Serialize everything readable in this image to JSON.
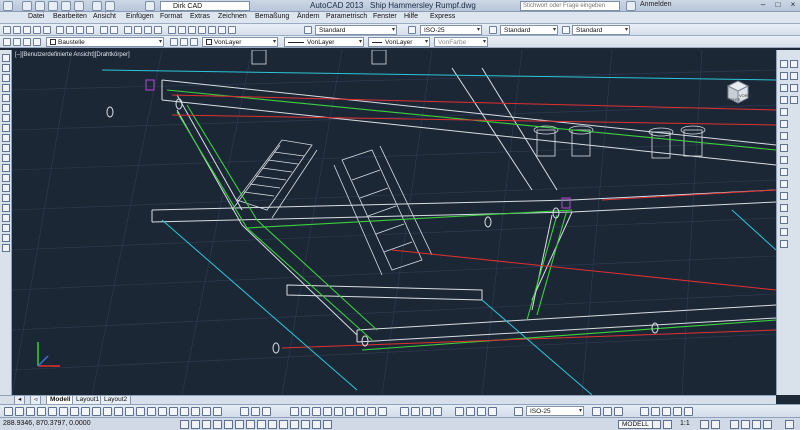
{
  "titlebar": {
    "workspace": "Dirk CAD",
    "app_name": "AutoCAD 2013",
    "document": "Ship Hammersley Rumpf.dwg",
    "search_placeholder": "Stichwort oder Frage eingeben",
    "login": "Anmelden"
  },
  "menu": [
    "Datei",
    "Bearbeiten",
    "Ansicht",
    "Einfügen",
    "Format",
    "Extras",
    "Zeichnen",
    "Bemaßung",
    "Ändern",
    "Parametrisch",
    "Fenster",
    "Hilfe",
    "Express"
  ],
  "toolbar1": {
    "textstyle": "Standard",
    "dimstyle": "ISO-25",
    "tablestyle": "Standard",
    "mleaderstyle": "Standard"
  },
  "toolbar2": {
    "layer": "Baustelle",
    "color": "VonLayer",
    "linetype": "VonLayer",
    "lineweight": "VonLayer",
    "plotstyle": "VonFarbe"
  },
  "viewport_label": "[–][Benutzerdefinierte Ansicht][Drahtkörper]",
  "viewcube": {
    "face": "VORNE",
    "secondary": "RECHTS"
  },
  "tabs": [
    "Modell",
    "Layout1",
    "Layout2"
  ],
  "bottom_toolbar": {
    "dimstyle": "ISO-25"
  },
  "status": {
    "coordinates": "288.9346, 870.3797, 0.0000",
    "model": "MODELL",
    "scale": "1:1"
  },
  "colors": {
    "background": "#1c2736",
    "grid": "#2f3d52",
    "wire_white": "#d8dde3",
    "green": "#3ccf3c",
    "red": "#e03030",
    "cyan": "#29c6d8",
    "magenta": "#c040e0"
  }
}
